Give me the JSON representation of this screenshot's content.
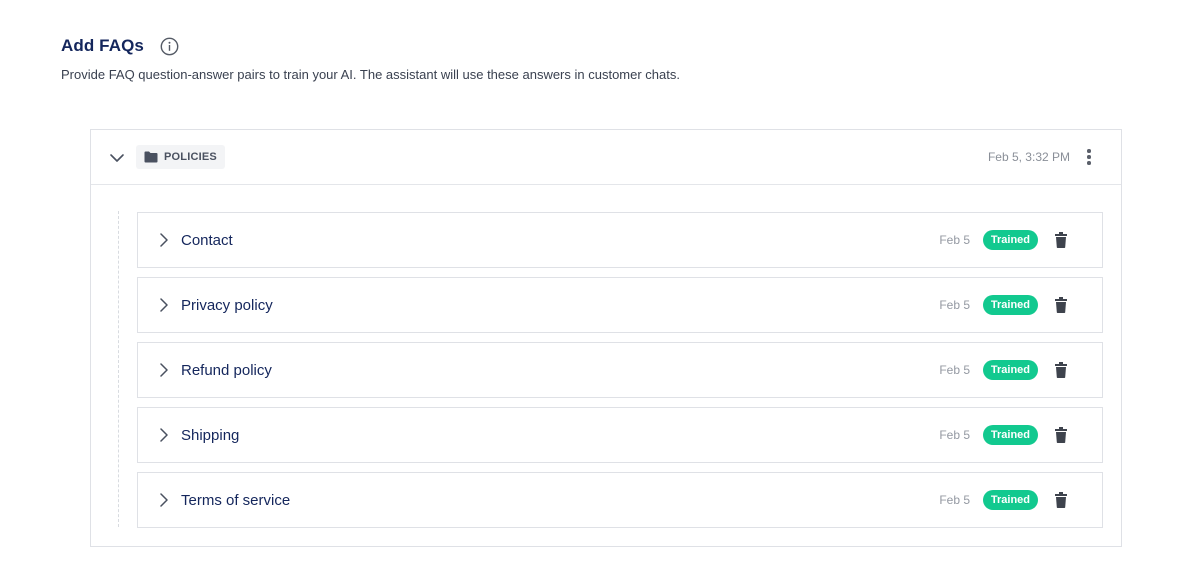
{
  "header": {
    "title": "Add FAQs",
    "subtitle": "Provide FAQ question-answer pairs to train your AI. The assistant will use these answers in customer chats."
  },
  "folder": {
    "label": "POLICIES",
    "date": "Feb 5, 3:32 PM"
  },
  "faqs": [
    {
      "title": "Contact",
      "date": "Feb 5",
      "status": "Trained"
    },
    {
      "title": "Privacy policy",
      "date": "Feb 5",
      "status": "Trained"
    },
    {
      "title": "Refund policy",
      "date": "Feb 5",
      "status": "Trained"
    },
    {
      "title": "Shipping",
      "date": "Feb 5",
      "status": "Trained"
    },
    {
      "title": "Terms of service",
      "date": "Feb 5",
      "status": "Trained"
    }
  ],
  "colors": {
    "title": "#14265c",
    "badge": "#12c98f",
    "border": "#dfe1e6"
  },
  "icons": {
    "info": "info-circle-icon",
    "folder": "folder-icon",
    "expand": "chevron-down-icon",
    "collapse": "chevron-right-icon",
    "menu": "more-vertical-icon",
    "delete": "trash-icon"
  }
}
